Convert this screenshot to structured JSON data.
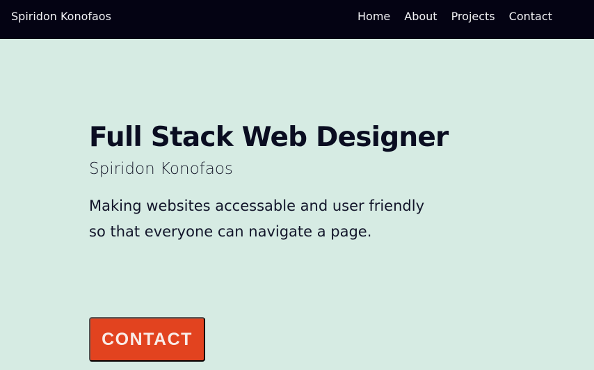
{
  "header": {
    "brand": "Spiridon Konofaos",
    "nav": [
      "Home",
      "About",
      "Projects",
      "Contact"
    ]
  },
  "hero": {
    "title": "Full Stack Web Designer",
    "subtitle": "Spiridon Konofaos",
    "description": "Making websites accessable and user friendly so that everyone can navigate a page.",
    "cta_label": "CONTACT"
  },
  "colors": {
    "header_background": "#040313",
    "page_background": "#d6ebe3",
    "accent_button": "#e2431f",
    "text": "#0a0d21"
  }
}
